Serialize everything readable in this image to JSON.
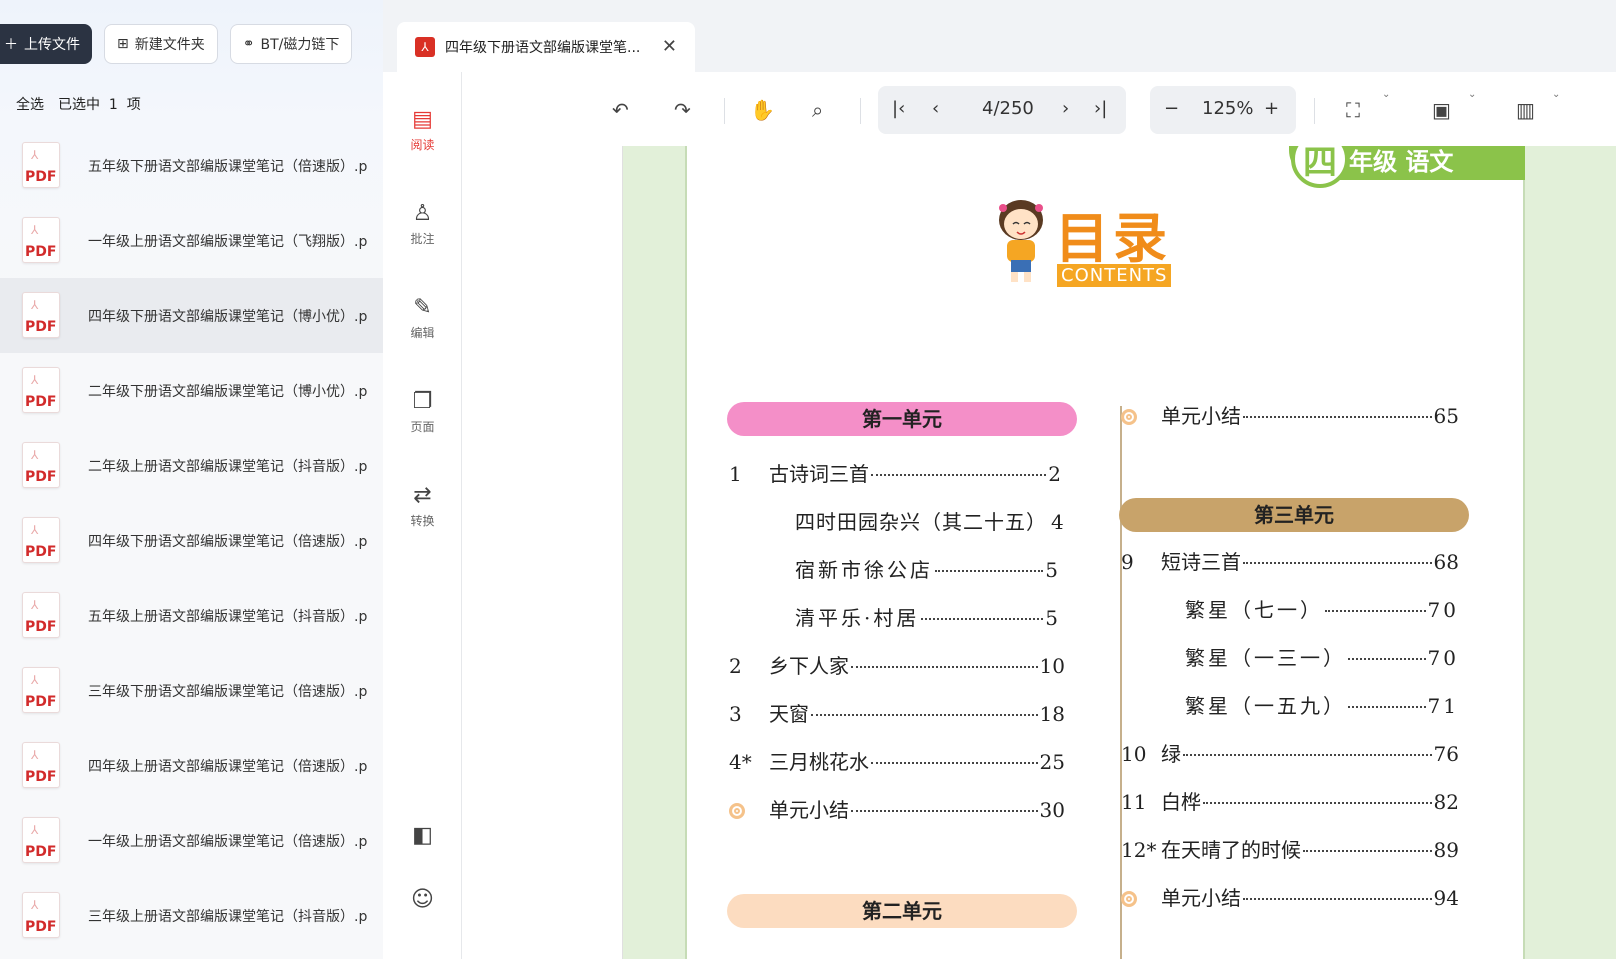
{
  "left": {
    "upload_label": "上传文件",
    "new_folder_label": "新建文件夹",
    "bt_label": "BT/磁力链下",
    "select_all": "全选",
    "selected_text": "已选中",
    "selected_count": "1",
    "selected_unit": "项",
    "files": [
      {
        "name": "五年级下册语文部编版课堂笔记（倍速版）.p"
      },
      {
        "name": "一年级上册语文部编版课堂笔记（飞翔版）.p"
      },
      {
        "name": "四年级下册语文部编版课堂笔记（博小优）.p"
      },
      {
        "name": "二年级下册语文部编版课堂笔记（博小优）.p"
      },
      {
        "name": "二年级上册语文部编版课堂笔记（抖音版）.p"
      },
      {
        "name": "四年级下册语文部编版课堂笔记（倍速版）.p"
      },
      {
        "name": "五年级上册语文部编版课堂笔记（抖音版）.p"
      },
      {
        "name": "三年级下册语文部编版课堂笔记（倍速版）.p"
      },
      {
        "name": "四年级上册语文部编版课堂笔记（倍速版）.p"
      },
      {
        "name": "一年级上册语文部编版课堂笔记（倍速版）.p"
      },
      {
        "name": "三年级上册语文部编版课堂笔记（抖音版）.p"
      }
    ],
    "pdf_tag": "PDF"
  },
  "tab": {
    "title": "四年级下册语文部编版课堂笔...",
    "badge": "⅄"
  },
  "sidebar": {
    "read": "阅读",
    "annotate": "批注",
    "edit": "编辑",
    "pages": "页面",
    "convert": "转换"
  },
  "toolbar": {
    "page": "4/250",
    "zoom": "125%"
  },
  "doc": {
    "grade_label": "年级 语文",
    "grade_num": "四",
    "title": "目录",
    "subtitle": "CONTENTS",
    "unit1": "第一单元",
    "unit2": "第二单元",
    "unit3": "第三单元",
    "left_entries": [
      {
        "num": "1",
        "title": "古诗词三首",
        "page": "2"
      },
      {
        "num": "",
        "title": "四时田园杂兴（其二十五）",
        "page": "4"
      },
      {
        "num": "",
        "title": "宿新市徐公店",
        "page": "5"
      },
      {
        "num": "",
        "title": "清平乐·村居",
        "page": "5"
      },
      {
        "num": "2",
        "title": "乡下人家",
        "page": "10"
      },
      {
        "num": "3",
        "title": "天窗",
        "page": "18"
      },
      {
        "num": "4*",
        "title": "三月桃花水",
        "page": "25"
      },
      {
        "num": "",
        "title": "单元小结",
        "page": "30"
      }
    ],
    "right_entries": [
      {
        "num": "",
        "title": "单元小结",
        "page": "65"
      },
      {
        "num": "9",
        "title": "短诗三首",
        "page": "68"
      },
      {
        "num": "",
        "title": "繁星（七一）",
        "page": "70"
      },
      {
        "num": "",
        "title": "繁星（一三一）",
        "page": "70"
      },
      {
        "num": "",
        "title": "繁星（一五九）",
        "page": "71"
      },
      {
        "num": "10",
        "title": "绿",
        "page": "76"
      },
      {
        "num": "11",
        "title": "白桦",
        "page": "82"
      },
      {
        "num": "12*",
        "title": "在天晴了的时候",
        "page": "89"
      },
      {
        "num": "",
        "title": "单元小结",
        "page": "94"
      }
    ]
  }
}
